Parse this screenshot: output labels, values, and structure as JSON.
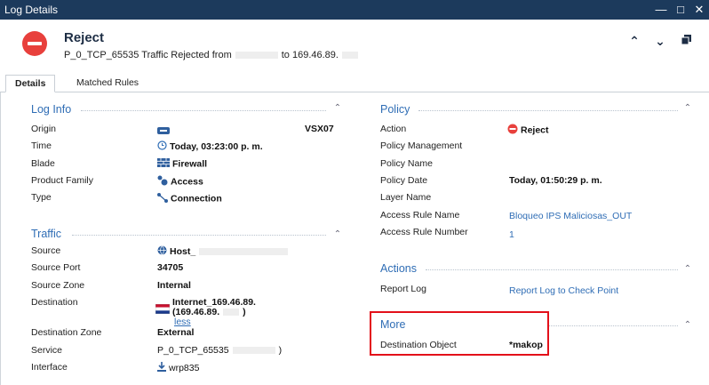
{
  "window": {
    "title": "Log Details"
  },
  "header": {
    "title": "Reject",
    "subtitle_prefix": "P_0_TCP_65535 Traffic Rejected from",
    "subtitle_mid": "to 169.46.89."
  },
  "tabs": [
    {
      "label": "Details"
    },
    {
      "label": "Matched Rules"
    }
  ],
  "log_info": {
    "title": "Log Info",
    "rows": [
      {
        "label": "Origin",
        "value": "VSX07"
      },
      {
        "label": "Time",
        "value": "Today, 03:23:00 p. m."
      },
      {
        "label": "Blade",
        "value": "Firewall"
      },
      {
        "label": "Product Family",
        "value": "Access"
      },
      {
        "label": "Type",
        "value": "Connection"
      }
    ]
  },
  "traffic": {
    "title": "Traffic",
    "rows": [
      {
        "label": "Source",
        "value": "Host_"
      },
      {
        "label": "Source Port",
        "value": "34705"
      },
      {
        "label": "Source Zone",
        "value": "Internal"
      },
      {
        "label": "Destination",
        "value": "Internet_169.46.89.",
        "value2": "(169.46.89.",
        "value2_end": ")",
        "more_link": "less"
      },
      {
        "label": "Destination Zone",
        "value": "External"
      },
      {
        "label": "Service",
        "value": "P_0_TCP_65535",
        "value_end": ")"
      },
      {
        "label": "Interface",
        "value": "wrp835"
      }
    ]
  },
  "policy": {
    "title": "Policy",
    "rows": [
      {
        "label": "Action",
        "value": "Reject"
      },
      {
        "label": "Policy Management",
        "value": ""
      },
      {
        "label": "Policy Name",
        "value": ""
      },
      {
        "label": "Policy Date",
        "value": "Today, 01:50:29 p. m."
      },
      {
        "label": "Layer Name",
        "value": ""
      },
      {
        "label": "Access Rule Name",
        "value": "Bloqueo IPS Maliciosas_OUT"
      },
      {
        "label": "Access Rule Number",
        "value": "1"
      }
    ]
  },
  "actions": {
    "title": "Actions",
    "rows": [
      {
        "label": "Report Log",
        "value": "Report Log to Check Point"
      }
    ]
  },
  "more": {
    "title": "More",
    "rows": [
      {
        "label": "Destination Object",
        "value": "*makop"
      }
    ]
  },
  "colors": {
    "titlebar": "#1c3a5c",
    "accent": "#2f6db5",
    "reject": "#e8403c",
    "highlight": "#e3101a"
  }
}
